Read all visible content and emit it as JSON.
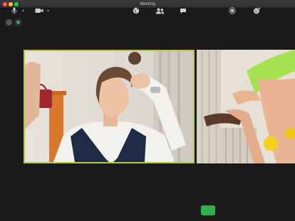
{
  "window": {
    "title": "Meeting"
  },
  "colors": {
    "active_speaker_border": "#b7c94a",
    "share_button": "#2db14a",
    "background": "#1a1a1a"
  },
  "top_controls": [
    {
      "name": "info-icon"
    },
    {
      "name": "shield-icon"
    }
  ],
  "participants": [
    {
      "name": "participant-video-1",
      "active_speaker": true
    },
    {
      "name": "participant-video-2",
      "active_speaker": false
    }
  ],
  "toolbar": {
    "items": [
      "microphone-icon",
      "video-camera-icon",
      "globe-icon",
      "participants-icon",
      "chat-icon",
      "share-screen-button",
      "record-icon",
      "reactions-icon"
    ]
  }
}
